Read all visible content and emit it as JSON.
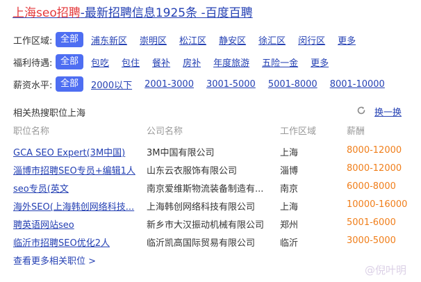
{
  "title": {
    "highlight": "上海seo招聘",
    "rest": "-最新招聘信息1925条 -百度百聘"
  },
  "filters": [
    {
      "label": "工作区域:",
      "selected": "全部",
      "options": [
        "浦东新区",
        "崇明区",
        "松江区",
        "静安区",
        "徐汇区",
        "闵行区",
        "更多"
      ]
    },
    {
      "label": "福利待遇:",
      "selected": "全部",
      "options": [
        "包吃",
        "包住",
        "餐补",
        "房补",
        "年度旅游",
        "五险一金",
        "更多"
      ]
    },
    {
      "label": "薪资水平:",
      "selected": "全部",
      "options": [
        "2000以下",
        "2001-3000",
        "3001-5000",
        "5001-8000",
        "8001-10000"
      ]
    }
  ],
  "section": {
    "title": "相关热搜职位上海",
    "swap_label": "换一换",
    "refresh_icon": "refresh-icon"
  },
  "table": {
    "headers": [
      "职位名称",
      "公司名称",
      "工作区域",
      "薪酬"
    ],
    "rows": [
      {
        "job": "GCA SEO Expert(3M中国)",
        "company": "3M中国有限公司",
        "area": "上海",
        "salary": "8000-12000"
      },
      {
        "job": "淄博市招聘SEO专员+编辑1人",
        "company": "山东云衣服饰有限公司",
        "area": "淄博",
        "salary": "8000-12000"
      },
      {
        "job": "seo专员(英文",
        "company": "南京爱维斯物流装备制造有...",
        "area": "南京",
        "salary": "6000-8000"
      },
      {
        "job": "海外SEO(上海韩创网络科技...",
        "company": "上海韩创网络科技有限公司",
        "area": "上海",
        "salary": "10000-16000"
      },
      {
        "job": "聘英语网站seo",
        "company": "新乡市大汉振动机械有限公司",
        "area": "郑州",
        "salary": "5001-6000"
      },
      {
        "job": "临沂市招聘SEO优化2人",
        "company": "临沂凯高国际贸易有限公司",
        "area": "临沂",
        "salary": "3000-5000"
      }
    ]
  },
  "more_link": "查看更多相关职位 >",
  "watermark": "@倪叶明",
  "colors": {
    "link": "#2440b3",
    "chip_bg": "#4e6ef2",
    "salary": "#f07e1a",
    "highlight": "#e4393c"
  }
}
